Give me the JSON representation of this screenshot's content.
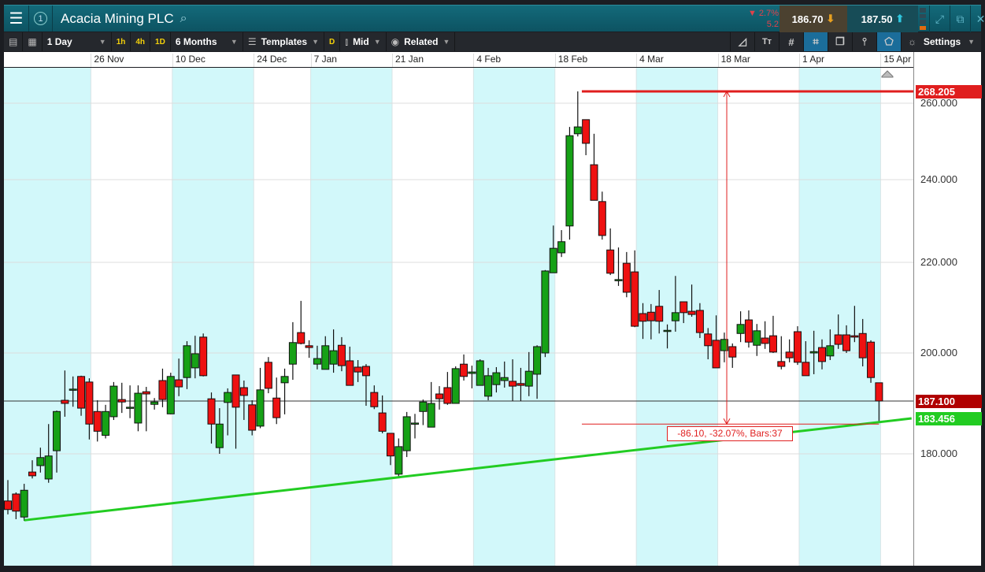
{
  "header": {
    "title": "Acacia Mining PLC",
    "account_number": "1",
    "change_pct": "▼ 2.7%",
    "change_abs": "5.2",
    "sell_price": "186.70",
    "buy_price": "187.50",
    "sell_arrow": "⬇",
    "buy_arrow": "⬆"
  },
  "toolbar": {
    "interval": "1 Day",
    "quick_intervals": [
      "1h",
      "4h",
      "1D"
    ],
    "range": "6 Months",
    "templates": "Templates",
    "d_label": "D",
    "price_type": "Mid",
    "related": "Related",
    "settings": "Settings"
  },
  "colors": {
    "up": "#16a116",
    "down": "#ee1111",
    "trend": "#22cc22",
    "measure": "#e01e1e",
    "band": "#d2f8fa"
  },
  "chart_data": {
    "type": "candlestick",
    "title": "Acacia Mining PLC",
    "period": "1 Day",
    "yticks": [
      260,
      240,
      220,
      200,
      180
    ],
    "ytick_labels": [
      "260.000",
      "240.000",
      "220.000",
      "200.000",
      "180.000"
    ],
    "x_labels": [
      {
        "label": "26 Nov",
        "bar": 10
      },
      {
        "label": "10 Dec",
        "bar": 20
      },
      {
        "label": "24 Dec",
        "bar": 30
      },
      {
        "label": "7 Jan",
        "bar": 37
      },
      {
        "label": "21 Jan",
        "bar": 47
      },
      {
        "label": "4 Feb",
        "bar": 57
      },
      {
        "label": "18 Feb",
        "bar": 67
      },
      {
        "label": "4 Mar",
        "bar": 77
      },
      {
        "label": "18 Mar",
        "bar": 87
      },
      {
        "label": "1 Apr",
        "bar": 97
      },
      {
        "label": "15 Apr",
        "bar": 107
      }
    ],
    "ohlc": [
      [
        171.2,
        175.1,
        168.7,
        169.6
      ],
      [
        172.5,
        172.8,
        167.8,
        169.3
      ],
      [
        168.2,
        174.4,
        167.5,
        173.2
      ],
      [
        176.6,
        178.8,
        175.4,
        175.9
      ],
      [
        177.8,
        180.6,
        176.5,
        179.3
      ],
      [
        175.3,
        182.9,
        174.6,
        179.6
      ],
      [
        180.3,
        185.1,
        176.5,
        184.9
      ],
      [
        187.3,
        195.3,
        183.8,
        186.6
      ],
      [
        190.3,
        193.7,
        185.9,
        190.3
      ],
      [
        193.7,
        193.9,
        184.0,
        185.6
      ],
      [
        192.2,
        193.2,
        181.4,
        182.9
      ],
      [
        184.9,
        187.3,
        181.2,
        182.2
      ],
      [
        181.8,
        186.3,
        181.5,
        184.9
      ],
      [
        183.8,
        192.2,
        183.3,
        191.1
      ],
      [
        187.5,
        192.0,
        184.6,
        186.9
      ],
      [
        185.8,
        191.3,
        183.5,
        185.8
      ],
      [
        183.0,
        191.3,
        182.2,
        189.2
      ],
      [
        189.6,
        190.9,
        182.2,
        189.0
      ],
      [
        186.4,
        187.9,
        185.3,
        186.9
      ],
      [
        192.6,
        195.8,
        185.8,
        187.5
      ],
      [
        184.4,
        194.7,
        184.3,
        193.7
      ],
      [
        192.8,
        198.5,
        188.4,
        190.9
      ],
      [
        193.4,
        202.6,
        190.3,
        201.6
      ],
      [
        196.0,
        203.8,
        193.2,
        199.8
      ],
      [
        203.5,
        204.3,
        193.7,
        193.9
      ],
      [
        187.7,
        189.4,
        181.0,
        182.9
      ],
      [
        180.6,
        185.6,
        180.0,
        182.9
      ],
      [
        186.8,
        190.5,
        181.8,
        189.4
      ],
      [
        194.1,
        194.1,
        180.5,
        185.8
      ],
      [
        190.7,
        192.6,
        183.3,
        188.6
      ],
      [
        186.3,
        187.3,
        181.8,
        182.3
      ],
      [
        182.7,
        196.0,
        182.5,
        190.1
      ],
      [
        197.5,
        198.9,
        189.2,
        190.5
      ],
      [
        187.9,
        193.4,
        182.9,
        183.6
      ],
      [
        192.0,
        195.8,
        184.3,
        193.7
      ],
      [
        197.0,
        206.8,
        192.8,
        202.3
      ],
      [
        204.5,
        211.5,
        201.9,
        202.1
      ],
      [
        201.6,
        202.8,
        198.7,
        201.2
      ],
      [
        197.0,
        201.6,
        195.6,
        198.5
      ],
      [
        195.6,
        203.7,
        195.6,
        201.6
      ],
      [
        197.0,
        205.2,
        194.7,
        200.5
      ],
      [
        201.7,
        203.5,
        195.1,
        196.6
      ],
      [
        197.9,
        201.4,
        191.3,
        191.3
      ],
      [
        196.2,
        198.1,
        192.2,
        194.9
      ],
      [
        196.4,
        197.0,
        186.1,
        193.9
      ],
      [
        189.4,
        191.3,
        185.4,
        185.9
      ],
      [
        184.6,
        188.6,
        182.0,
        182.2
      ],
      [
        182.0,
        182.0,
        177.9,
        179.6
      ],
      [
        176.2,
        181.5,
        175.7,
        180.7
      ],
      [
        180.3,
        184.8,
        179.4,
        183.8
      ],
      [
        183.0,
        184.4,
        181.5,
        183.0
      ],
      [
        184.9,
        187.5,
        182.8,
        186.9
      ],
      [
        182.6,
        192.2,
        182.6,
        186.6
      ],
      [
        189.0,
        191.1,
        185.3,
        187.7
      ],
      [
        190.7,
        194.9,
        186.3,
        186.6
      ],
      [
        186.6,
        196.4,
        186.6,
        195.8
      ],
      [
        197.0,
        199.6,
        192.6,
        193.7
      ],
      [
        194.5,
        196.6,
        190.5,
        194.9
      ],
      [
        191.3,
        198.3,
        191.3,
        197.9
      ],
      [
        188.4,
        196.0,
        187.3,
        193.9
      ],
      [
        191.5,
        196.2,
        189.4,
        194.7
      ],
      [
        192.6,
        197.7,
        190.7,
        193.4
      ],
      [
        192.4,
        198.3,
        187.1,
        191.1
      ],
      [
        191.8,
        196.0,
        187.1,
        191.3
      ],
      [
        191.1,
        200.2,
        188.4,
        195.1
      ],
      [
        194.3,
        201.7,
        187.7,
        201.4
      ],
      [
        200.0,
        218.3,
        198.9,
        218.1
      ],
      [
        217.7,
        228.9,
        217.7,
        223.4
      ],
      [
        222.3,
        227.8,
        221.3,
        225.0
      ],
      [
        228.8,
        253.8,
        225.5,
        251.5
      ],
      [
        252.0,
        268.2,
        251.3,
        253.8
      ],
      [
        255.7,
        255.7,
        246.4,
        249.5
      ],
      [
        243.9,
        252.0,
        235.0,
        235.0
      ],
      [
        234.7,
        237.1,
        225.5,
        226.5
      ],
      [
        223.0,
        228.2,
        217.2,
        217.6
      ],
      [
        216.2,
        223.6,
        214.8,
        216.2
      ],
      [
        219.8,
        222.5,
        212.3,
        213.4
      ],
      [
        217.9,
        222.9,
        205.7,
        205.9
      ],
      [
        208.7,
        211.0,
        203.1,
        207.0
      ],
      [
        209.0,
        210.8,
        203.0,
        207.1
      ],
      [
        210.3,
        213.9,
        204.3,
        207.0
      ],
      [
        205.0,
        206.3,
        201.0,
        205.0
      ],
      [
        207.1,
        217.0,
        204.7,
        208.9
      ],
      [
        211.3,
        211.3,
        206.6,
        208.9
      ],
      [
        209.2,
        215.1,
        208.0,
        208.5
      ],
      [
        209.4,
        211.0,
        203.3,
        204.5
      ],
      [
        204.2,
        205.5,
        198.3,
        201.6
      ],
      [
        202.8,
        208.3,
        196.0,
        196.0
      ],
      [
        200.5,
        204.5,
        197.5,
        203.0
      ],
      [
        201.4,
        202.1,
        196.0,
        198.9
      ],
      [
        204.3,
        209.2,
        202.4,
        206.3
      ],
      [
        207.3,
        209.4,
        201.2,
        202.4
      ],
      [
        201.7,
        206.4,
        199.2,
        204.9
      ],
      [
        203.3,
        207.0,
        200.9,
        202.1
      ],
      [
        203.8,
        208.2,
        200.0,
        200.2
      ],
      [
        197.7,
        203.7,
        195.6,
        196.4
      ],
      [
        200.2,
        203.0,
        197.5,
        198.7
      ],
      [
        204.7,
        205.9,
        196.8,
        197.5
      ],
      [
        197.5,
        202.6,
        193.9,
        193.9
      ],
      [
        200.0,
        204.9,
        194.3,
        200.3
      ],
      [
        201.2,
        203.0,
        195.6,
        197.7
      ],
      [
        199.2,
        205.2,
        198.1,
        201.6
      ],
      [
        204.0,
        208.5,
        200.9,
        201.9
      ],
      [
        204.0,
        206.1,
        200.0,
        200.5
      ],
      [
        203.8,
        210.4,
        202.4,
        203.5
      ],
      [
        204.3,
        207.5,
        196.4,
        198.7
      ],
      [
        202.4,
        202.8,
        192.0,
        193.4
      ],
      [
        192.0,
        192.0,
        183.0,
        187.1
      ]
    ],
    "current_price": {
      "value": 187.1,
      "label": "187.100"
    },
    "high_line": {
      "value": 268.205,
      "label": "268.205",
      "from_bar": 70.5
    },
    "low_line": {
      "value": 182.9,
      "from_bar": 70.5,
      "to_bar": 107
    },
    "trendline": {
      "start": {
        "bar": 2,
        "price": 167.6
      },
      "end": {
        "bar": 111,
        "price": 183.456
      },
      "label": "183.456"
    },
    "measurement": {
      "bar": 88.3,
      "text": "-86.10, -32.07%, Bars:37"
    }
  }
}
